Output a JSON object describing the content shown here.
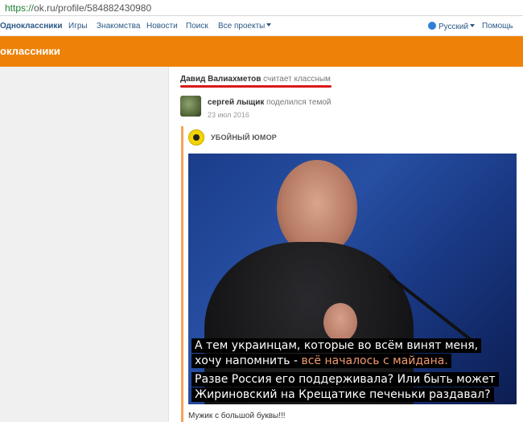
{
  "browser": {
    "url_scheme": "https://",
    "url_rest": "ok.ru/profile/584882430980"
  },
  "nav": {
    "brand": "Одноклассники",
    "items": [
      "Игры",
      "Знакомства",
      "Новости",
      "Поиск",
      "Все проекты"
    ],
    "language": "Русский",
    "help": "Помощь"
  },
  "header": {
    "logo_text": "оклассники"
  },
  "feed": {
    "liked_by": "Давид Валиахметов",
    "liked_action": "считает классным",
    "author": "сергей лыщик",
    "author_action": "поделился темой",
    "date": "23 июл 2016",
    "group": "УБОЙНЫЙ ЮМОР",
    "caption": {
      "line1": "А тем украинцам, которые во всём винят меня,",
      "line2_a": "хочу напомнить - ",
      "line2_b": "всё началось с майдана.",
      "line3": "Разве Россия его поддерживала? Или быть может",
      "line4": "Жириновский на Крещатике печеньки раздавал?"
    },
    "comment": "Мужик с большой буквы!!!"
  },
  "colors": {
    "orange": "#ee8208",
    "link": "#2a5885",
    "underline": "#d91818",
    "repost_line": "#f5a25a"
  }
}
